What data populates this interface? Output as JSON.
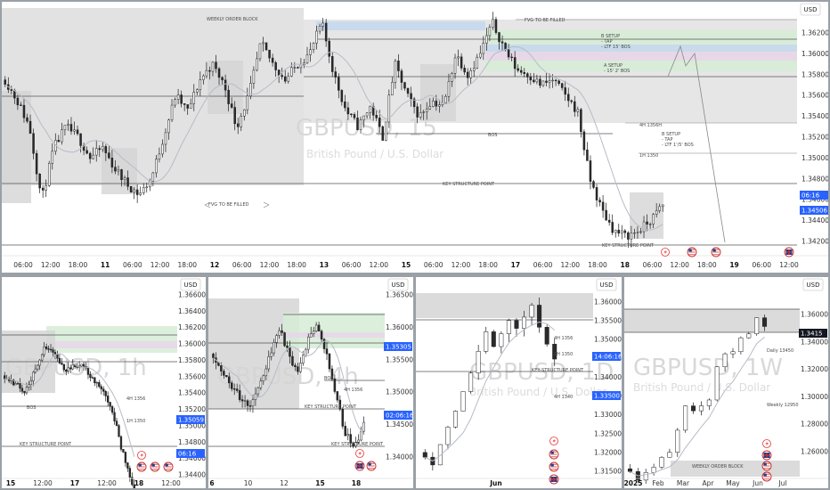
{
  "colors": {
    "bull": "#ffffff",
    "bear": "#2a2a2a",
    "wick": "#1e1e1e",
    "ma": "#b6bcc6",
    "zone_gray": "#d5d5d5",
    "zone_green": "#d6ecd6",
    "zone_blue": "#c7d8ee",
    "zone_pink": "#e9d6ea",
    "price_tag": "#2962ff",
    "price_tag_dark": "#131722",
    "event_red": "#e53935"
  },
  "icons": [
    "lightning-icon",
    "us-flag-icon",
    "uk-flag-icon"
  ],
  "chart_data": [
    {
      "type": "candlestick",
      "panel": "main-15m",
      "currency": "USD",
      "watermark_symbol": "GBPUSD, 15",
      "watermark_name": "British Pound / U.S. Dollar",
      "y_ticks": [
        "1.36200",
        "1.36000",
        "1.35800",
        "1.35600",
        "1.35400",
        "1.35200",
        "1.35000",
        "1.34800",
        "1.34600",
        "1.34400",
        "1.34200"
      ],
      "ylim": [
        1.3412,
        1.3643
      ],
      "x_ticks": [
        {
          "label": "06:00",
          "bold": false
        },
        {
          "label": "12:00",
          "bold": false
        },
        {
          "label": "18:00",
          "bold": false
        },
        {
          "label": "11",
          "bold": true
        },
        {
          "label": "06:00",
          "bold": false
        },
        {
          "label": "12:00",
          "bold": false
        },
        {
          "label": "18:00",
          "bold": false
        },
        {
          "label": "12",
          "bold": true
        },
        {
          "label": "06:00",
          "bold": false
        },
        {
          "label": "12:00",
          "bold": false
        },
        {
          "label": "18:00",
          "bold": false
        },
        {
          "label": "13",
          "bold": true
        },
        {
          "label": "06:00",
          "bold": false
        },
        {
          "label": "12:00",
          "bold": false
        },
        {
          "label": "15",
          "bold": true
        },
        {
          "label": "06:00",
          "bold": false
        },
        {
          "label": "12:00",
          "bold": false
        },
        {
          "label": "18:00",
          "bold": false
        },
        {
          "label": "17",
          "bold": true
        },
        {
          "label": "06:00",
          "bold": false
        },
        {
          "label": "12:00",
          "bold": false
        },
        {
          "label": "18:00",
          "bold": false
        },
        {
          "label": "18",
          "bold": true
        },
        {
          "label": "06:00",
          "bold": false
        },
        {
          "label": "12:00",
          "bold": false
        },
        {
          "label": "18:00",
          "bold": false
        },
        {
          "label": "19",
          "bold": true
        },
        {
          "label": "06:00",
          "bold": false
        },
        {
          "label": "12:00",
          "bold": false
        }
      ],
      "price_path": [
        1.3575,
        1.3555,
        1.353,
        1.346,
        1.351,
        1.353,
        1.352,
        1.35,
        1.351,
        1.349,
        1.3475,
        1.3465,
        1.348,
        1.352,
        1.356,
        1.3545,
        1.3575,
        1.359,
        1.357,
        1.353,
        1.356,
        1.361,
        1.359,
        1.3575,
        1.359,
        1.36,
        1.363,
        1.358,
        1.3545,
        1.353,
        1.355,
        1.352,
        1.359,
        1.356,
        1.354,
        1.3555,
        1.355,
        1.36,
        1.358,
        1.36,
        1.363,
        1.3605,
        1.3585,
        1.358,
        1.357,
        1.3575,
        1.356,
        1.3545,
        1.348,
        1.345,
        1.343,
        1.3425,
        1.343,
        1.344,
        1.3455
      ],
      "labels": {
        "weekly_ob": "WEEKLY ORDER BLOCK",
        "fvg_top": "FVG TO BE FILLED",
        "fvg_mid": "FVG TO BE FILLED",
        "b_setup_top": "B SETUP\n- TAP\n- LTF 15' BOS",
        "a_setup": "A SETUP\n- 15' 2' BOS",
        "b_setup_mid": "B SETUP\n- TAP\n- LTF 1'/5' BOS",
        "bos": "BOS",
        "key_structure": "KEY STRUCTURE POINT",
        "key_structure_low": "KEY STRUCTURE POINT",
        "small_right_1": "4H 1356H",
        "small_right_2": "1H 1350"
      },
      "price_tags": {
        "time": "06:16",
        "price": "1.34506"
      }
    },
    {
      "type": "candlestick",
      "panel": "bottom-1",
      "currency": "USD",
      "watermark": "GBPUSD, 1h",
      "y_ticks": [
        "1.36600",
        "1.36400",
        "1.36200",
        "1.36000",
        "1.35800",
        "1.35600",
        "1.35400",
        "1.35200",
        "1.35000",
        "1.34800",
        "1.34600",
        "1.34400"
      ],
      "x_ticks": [
        {
          "label": "15",
          "bold": true
        },
        {
          "label": "12:00",
          "bold": false
        },
        {
          "label": "17",
          "bold": true
        },
        {
          "label": "12:00",
          "bold": false
        },
        {
          "label": "18",
          "bold": true
        },
        {
          "label": "12:00",
          "bold": false
        }
      ],
      "labels": {
        "bos": "BOS",
        "key_structure": "KEY STRUCTURE POINT",
        "small_1": "4H 1356",
        "small_2": "1H 1350"
      },
      "price_path": [
        1.3565,
        1.3555,
        1.3545,
        1.357,
        1.36,
        1.3595,
        1.357,
        1.358,
        1.3575,
        1.356,
        1.354,
        1.351,
        1.346,
        1.342
      ],
      "price_tags": {
        "price": "1.35059",
        "time": "06:16"
      }
    },
    {
      "type": "candlestick",
      "panel": "bottom-2",
      "currency": "USD",
      "watermark": "GBPUSD, 4h",
      "y_ticks": [
        "1.36500",
        "1.36000",
        "1.35500",
        "1.35000",
        "1.34500",
        "1.34000"
      ],
      "x_ticks": [
        {
          "label": "6",
          "bold": true
        },
        {
          "label": "10",
          "bold": false
        },
        {
          "label": "12",
          "bold": false
        },
        {
          "label": "15",
          "bold": true
        },
        {
          "label": "18",
          "bold": true
        }
      ],
      "labels": {
        "bos": "BOS",
        "key_structure": "KEY STRUCTURE POINT",
        "key_structure_low": "KEY STRUCTURE POINT",
        "small_1": "4H 1356"
      },
      "price_path": [
        1.356,
        1.353,
        1.351,
        1.349,
        1.348,
        1.352,
        1.3555,
        1.36,
        1.356,
        1.353,
        1.358,
        1.36,
        1.356,
        1.35,
        1.344,
        1.342,
        1.345
      ],
      "price_tags": {
        "price": "1.35305",
        "time": "02:06:16"
      }
    },
    {
      "type": "candlestick",
      "panel": "bottom-3",
      "currency": "USD",
      "watermark": "GBPUSD, 1D",
      "watermark_name": "British Pound / U.S. Dollar",
      "y_ticks": [
        "1.36000",
        "1.35500",
        "1.35000",
        "1.34500",
        "1.34000",
        "1.33500",
        "1.33000",
        "1.32500",
        "1.32000",
        "1.31500"
      ],
      "x_ticks": [
        {
          "label": "Jun",
          "bold": true
        }
      ],
      "labels": {
        "key_structure": "KEY STRUCTURE POINT",
        "small_1": "4H 1356",
        "small_2": "1H 1350",
        "small_3": "4H 1340"
      },
      "price_path": [
        1.32,
        1.317,
        1.323,
        1.326,
        1.331,
        1.336,
        1.342,
        1.348,
        1.352,
        1.347,
        1.351,
        1.356,
        1.352,
        1.357,
        1.36,
        1.354,
        1.348,
        1.345
      ],
      "price_tags": {
        "time": "14:06:16",
        "price": "1.33500"
      }
    },
    {
      "type": "candlestick",
      "panel": "bottom-4",
      "currency": "USD",
      "watermark": "GBPUSD, 1W",
      "watermark_name": "British Pound / U.S. Dollar",
      "y_ticks": [
        "1.36000",
        "1.34000",
        "1.32000",
        "1.30000",
        "1.28000",
        "1.26000"
      ],
      "x_ticks": [
        {
          "label": "2025",
          "bold": true
        },
        {
          "label": "Feb",
          "bold": false
        },
        {
          "label": "Mar",
          "bold": false
        },
        {
          "label": "Apr",
          "bold": false
        },
        {
          "label": "May",
          "bold": false
        },
        {
          "label": "Jun",
          "bold": false
        },
        {
          "label": "Jul",
          "bold": false
        }
      ],
      "labels": {
        "weekly_ob": "WEEKLY ORDER BLOCK",
        "small_1": "Daily 13450",
        "small_2": "Weekly 12950"
      },
      "price_path": [
        1.249,
        1.242,
        1.247,
        1.25,
        1.256,
        1.26,
        1.276,
        1.293,
        1.289,
        1.294,
        1.299,
        1.323,
        1.332,
        1.333,
        1.345,
        1.346,
        1.356,
        1.352
      ],
      "price_tags": {
        "price": "1.3415"
      }
    }
  ]
}
